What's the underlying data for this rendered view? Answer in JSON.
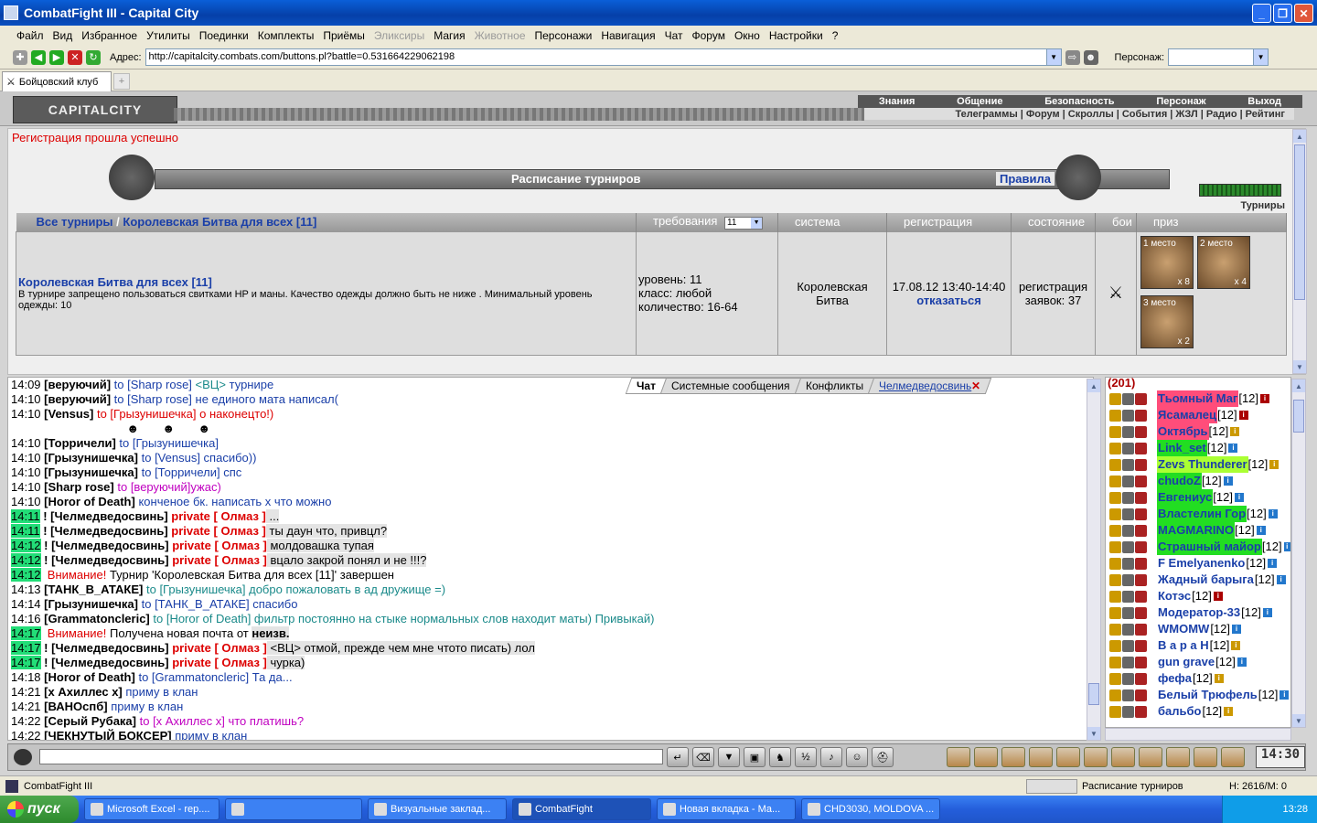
{
  "window": {
    "title": "CombatFight III - Capital City"
  },
  "menu": [
    "Файл",
    "Вид",
    "Избранное",
    "Утилиты",
    "Поединки",
    "Комплекты",
    "Приёмы",
    "Эликсиры",
    "Магия",
    "Животное",
    "Персонажи",
    "Навигация",
    "Чат",
    "Форум",
    "Окно",
    "Настройки",
    "?"
  ],
  "menu_disabled": [
    "Эликсиры",
    "Животное"
  ],
  "address": {
    "label": "Адрес:",
    "value": "http://capitalcity.combats.com/buttons.pl?battle=0.531664229062198",
    "person_label": "Персонаж:"
  },
  "tab": {
    "label": "Бойцовский клуб"
  },
  "header": {
    "logo": "CAPITALCITY",
    "nav": [
      "Знания",
      "Общение",
      "Безопасность",
      "Персонаж",
      "Выход"
    ],
    "subnav": [
      "Телеграммы",
      "Форум",
      "Скроллы",
      "События",
      "ЖЗЛ",
      "Радио",
      "Рейтинг"
    ]
  },
  "notice": "Регистрация прошла успешно",
  "banner": {
    "title": "Расписание турниров",
    "rules": "Правила",
    "side_label": "Турниры"
  },
  "table": {
    "breadcrumb_all": "Все турниры",
    "breadcrumb_sep": "/",
    "breadcrumb_current": "Королевская Битва для всех [11]",
    "columns": [
      "требования",
      "система",
      "регистрация",
      "состояние",
      "бои",
      "приз"
    ],
    "level_select": "11",
    "row": {
      "name": "Королевская Битва для всех [11]",
      "desc": "В турнире запрещено пользоваться свитками HP и маны. Качество одежды должно быть не ниже . Минимальный уровень одежды: 10",
      "req": [
        "уровень: 11",
        "класс: любой",
        "количество: 16-64"
      ],
      "system": "Королевская Битва",
      "reg_date": "17.08.12 13:40-14:40",
      "reg_action": "отказаться",
      "status": "регистрация заявок: 37"
    },
    "prizes": [
      {
        "place": "1 место",
        "count": "x 8"
      },
      {
        "place": "2 место",
        "count": "x 4"
      },
      {
        "place": "3 место",
        "count": "x 2"
      }
    ]
  },
  "chat_tabs": [
    "Чат",
    "Системные сообщения",
    "Конфликты",
    "Челмедведосвинь"
  ],
  "chat": [
    {
      "t": "14:09",
      "parts": [
        [
          "n",
          "[веруючий]"
        ],
        [
          "b",
          " to [Sharp rose] "
        ],
        [
          "g",
          "<ВЦ>"
        ],
        [
          "b",
          " турнире"
        ]
      ]
    },
    {
      "t": "14:10",
      "parts": [
        [
          "n",
          "[веруючий]"
        ],
        [
          "b",
          " to [Sharp rose] не единого мата написал("
        ]
      ]
    },
    {
      "t": "14:10",
      "parts": [
        [
          "n",
          "[Vensus]"
        ],
        [
          "r",
          " to [Грызунишечка] о наконецто!)"
        ]
      ]
    },
    {
      "t": "",
      "parts": [
        [
          "t",
          "                                   ☻       ☻       ☻"
        ]
      ]
    },
    {
      "t": "14:10",
      "parts": [
        [
          "n",
          "[Торричели]"
        ],
        [
          "b",
          " to [Грызунишечка]"
        ]
      ]
    },
    {
      "t": "14:10",
      "parts": [
        [
          "n",
          "[Грызунишечка]"
        ],
        [
          "b",
          " to [Vensus] спасибо))"
        ]
      ]
    },
    {
      "t": "14:10",
      "parts": [
        [
          "n",
          "[Грызунишечка]"
        ],
        [
          "b",
          " to [Торричели] спс"
        ]
      ]
    },
    {
      "t": "14:10",
      "parts": [
        [
          "n",
          "[Sharp rose]"
        ],
        [
          "m",
          " to [веруючий]ужас)"
        ]
      ]
    },
    {
      "t": "14:10",
      "parts": [
        [
          "n",
          "[Horor of Death]"
        ],
        [
          "b",
          " конченое бк. написать х что можно"
        ]
      ]
    },
    {
      "t": "14:11",
      "p": 1,
      "parts": [
        [
          "n",
          "! [Челмедведосвинь]"
        ],
        [
          "rb",
          " private [ Олмаз ]"
        ],
        [
          "t",
          " ..."
        ]
      ]
    },
    {
      "t": "14:11",
      "p": 1,
      "parts": [
        [
          "n",
          "! [Челмедведосвинь]"
        ],
        [
          "rb",
          " private [ Олмаз ]"
        ],
        [
          "t",
          " ты даун что, привцл?"
        ]
      ]
    },
    {
      "t": "14:12",
      "p": 1,
      "parts": [
        [
          "n",
          "! [Челмедведосвинь]"
        ],
        [
          "rb",
          " private [ Олмаз ]"
        ],
        [
          "t",
          " молдовашка тупая"
        ]
      ]
    },
    {
      "t": "14:12",
      "p": 1,
      "parts": [
        [
          "n",
          "! [Челмедведосвинь]"
        ],
        [
          "rb",
          " private [ Олмаз ]"
        ],
        [
          "t",
          " вцало закрой понял и не !!!?"
        ]
      ]
    },
    {
      "t": "14:12",
      "p": 1,
      "parts": [
        [
          "r",
          " Внимание!"
        ],
        [
          "t",
          " Турнир 'Королевская Битва для всех [11]' завершен"
        ]
      ]
    },
    {
      "t": "14:13",
      "parts": [
        [
          "n",
          "[ТАНК_В_АТАКЕ]"
        ],
        [
          "g",
          " to [Грызунишечка] добро пожаловать в ад дружище =)"
        ]
      ]
    },
    {
      "t": "14:14",
      "parts": [
        [
          "n",
          "[Грызунишечка]"
        ],
        [
          "b",
          " to [ТАНК_В_АТАКЕ] спасибо"
        ]
      ]
    },
    {
      "t": "14:16",
      "parts": [
        [
          "n",
          "[Grammatoncleric]"
        ],
        [
          "g",
          " to [Horor of Death] фильтр постоянно на стыке нормальных слов находит маты) Привыкай)"
        ]
      ]
    },
    {
      "t": "14:17",
      "p": 1,
      "parts": [
        [
          "r",
          " Внимание!"
        ],
        [
          "t",
          " Получена новая почта от "
        ],
        [
          "n",
          "неизв."
        ]
      ]
    },
    {
      "t": "14:17",
      "p": 1,
      "parts": [
        [
          "n",
          "! [Челмедведосвинь]"
        ],
        [
          "rb",
          " private [ Олмаз ]"
        ],
        [
          "t",
          " <ВЦ> отмой, прежде чем мне чтото писать) лол"
        ]
      ]
    },
    {
      "t": "14:17",
      "p": 1,
      "parts": [
        [
          "n",
          "! [Челмедведосвинь]"
        ],
        [
          "rb",
          " private [ Олмаз ]"
        ],
        [
          "t",
          " чурка)"
        ]
      ]
    },
    {
      "t": "14:18",
      "parts": [
        [
          "n",
          "[Horor of Death]"
        ],
        [
          "b",
          " to [Grammatoncleric] Та да..."
        ]
      ]
    },
    {
      "t": "14:21",
      "parts": [
        [
          "n",
          "[x Ахиллес x]"
        ],
        [
          "b",
          " приму в клан"
        ]
      ]
    },
    {
      "t": "14:21",
      "parts": [
        [
          "n",
          "[ВАНОспб]"
        ],
        [
          "b",
          " приму в клан"
        ]
      ]
    },
    {
      "t": "14:22",
      "parts": [
        [
          "n",
          "[Серый Рубака]"
        ],
        [
          "m",
          " to [x Ахиллес x] что платишь?"
        ]
      ]
    },
    {
      "t": "14:22",
      "parts": [
        [
          "n",
          "[ЧЕКНУТЫЙ БОКСЕР]"
        ],
        [
          "b",
          " приму в клан"
        ]
      ]
    }
  ],
  "users_count": "(201)",
  "users": [
    {
      "name": "Тьомный Маг",
      "lv": "[12]",
      "bg": "#ff4d7a",
      "info": "b"
    },
    {
      "name": "Ясамалец",
      "lv": "[12]",
      "bg": "#ff4d7a",
      "info": "b"
    },
    {
      "name": "Октябрь",
      "lv": "[12]",
      "bg": "#ff4d7a",
      "info": "y"
    },
    {
      "name": "Link_set",
      "lv": "[12]",
      "bg": "#22dd22",
      "info": ""
    },
    {
      "name": "Zevs Thunderer",
      "lv": "[12]",
      "bg": "#aaff33",
      "info": "y"
    },
    {
      "name": "chudoZ",
      "lv": "[12]",
      "bg": "#22dd22",
      "info": ""
    },
    {
      "name": "Евгениус",
      "lv": "[12]",
      "bg": "#22dd22",
      "info": ""
    },
    {
      "name": "Властелин Гор",
      "lv": "[12]",
      "bg": "#22dd22",
      "info": ""
    },
    {
      "name": "MAGMARINO",
      "lv": "[12]",
      "bg": "#22dd22",
      "info": ""
    },
    {
      "name": "Страшный майор",
      "lv": "[12]",
      "bg": "#22dd22",
      "info": ""
    },
    {
      "name": "F Emelyanenko",
      "lv": "[12]",
      "bg": "",
      "info": ""
    },
    {
      "name": "Жадный барыга",
      "lv": "[12]",
      "bg": "",
      "info": ""
    },
    {
      "name": "Котэс",
      "lv": "[12]",
      "bg": "",
      "info": "b"
    },
    {
      "name": "Модератор-33",
      "lv": "[12]",
      "bg": "",
      "info": ""
    },
    {
      "name": "WMOMW",
      "lv": "[12]",
      "bg": "",
      "info": ""
    },
    {
      "name": "В а р а Н",
      "lv": "[12]",
      "bg": "",
      "info": "y"
    },
    {
      "name": "gun grave",
      "lv": "[12]",
      "bg": "",
      "info": ""
    },
    {
      "name": "фефа",
      "lv": "[12]",
      "bg": "",
      "info": "y"
    },
    {
      "name": "Белый Трюфель",
      "lv": "[12]",
      "bg": "",
      "info": ""
    },
    {
      "name": "бальбо",
      "lv": "[12]",
      "bg": "",
      "info": "y"
    }
  ],
  "clock": "14:30",
  "status": {
    "left": "CombatFight III",
    "right1": "Расписание турниров",
    "right2": "H: 2616/M: 0"
  },
  "taskbar": {
    "start": "пуск",
    "tasks": [
      "Microsoft Excel - rep....",
      "",
      "Визуальные заклад...",
      "CombatFight",
      "Новая вкладка - Ма...",
      "CHD3030, MOLDOVA ..."
    ],
    "time": "13:28"
  }
}
